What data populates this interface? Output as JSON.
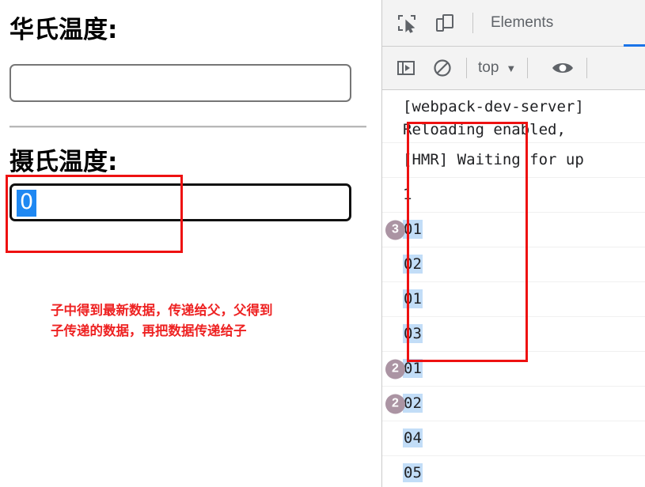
{
  "page": {
    "fahrenheit": {
      "label": "华氏温度:",
      "value": "",
      "placeholder": ""
    },
    "celsius": {
      "label": "摄氏温度:",
      "value": "0",
      "placeholder": "",
      "selected_text": "0"
    },
    "annotation": {
      "line1": "子中得到最新数据，传递给父，父得到",
      "line2": "子传递的数据，再把数据传递给子",
      "color": "#ee2222",
      "box_color": "#ee1111"
    }
  },
  "devtools": {
    "toolbar": {
      "inspect_icon": "inspect-element-icon",
      "device_icon": "device-toolbar-icon",
      "active_tab": "Elements"
    },
    "subbar": {
      "sidebar_icon": "console-sidebar-icon",
      "clear_icon": "clear-console-icon",
      "context": "top",
      "caret": "▼",
      "eye_icon": "eye-icon"
    },
    "accent_color": "#1a73e8",
    "console": {
      "messages": [
        {
          "badge": "",
          "lines": [
            "[webpack-dev-server]",
            "Reloading enabled, "
          ],
          "highlight": false,
          "two_line": true
        },
        {
          "badge": "",
          "lines": [
            "[HMR] Waiting for up"
          ],
          "highlight": false,
          "two_line": false
        },
        {
          "badge": "",
          "lines": [
            "1"
          ],
          "highlight": false,
          "two_line": false
        },
        {
          "badge": "3",
          "lines": [
            "01"
          ],
          "highlight": true,
          "two_line": false
        },
        {
          "badge": "",
          "lines": [
            "02"
          ],
          "highlight": true,
          "two_line": false
        },
        {
          "badge": "",
          "lines": [
            "01"
          ],
          "highlight": true,
          "two_line": false
        },
        {
          "badge": "",
          "lines": [
            "03"
          ],
          "highlight": true,
          "two_line": false
        },
        {
          "badge": "2",
          "lines": [
            "01"
          ],
          "highlight": true,
          "two_line": false
        },
        {
          "badge": "2",
          "lines": [
            "02"
          ],
          "highlight": true,
          "two_line": false
        },
        {
          "badge": "",
          "lines": [
            "04"
          ],
          "highlight": true,
          "two_line": false
        },
        {
          "badge": "",
          "lines": [
            "05"
          ],
          "highlight": true,
          "two_line": false
        }
      ]
    }
  }
}
